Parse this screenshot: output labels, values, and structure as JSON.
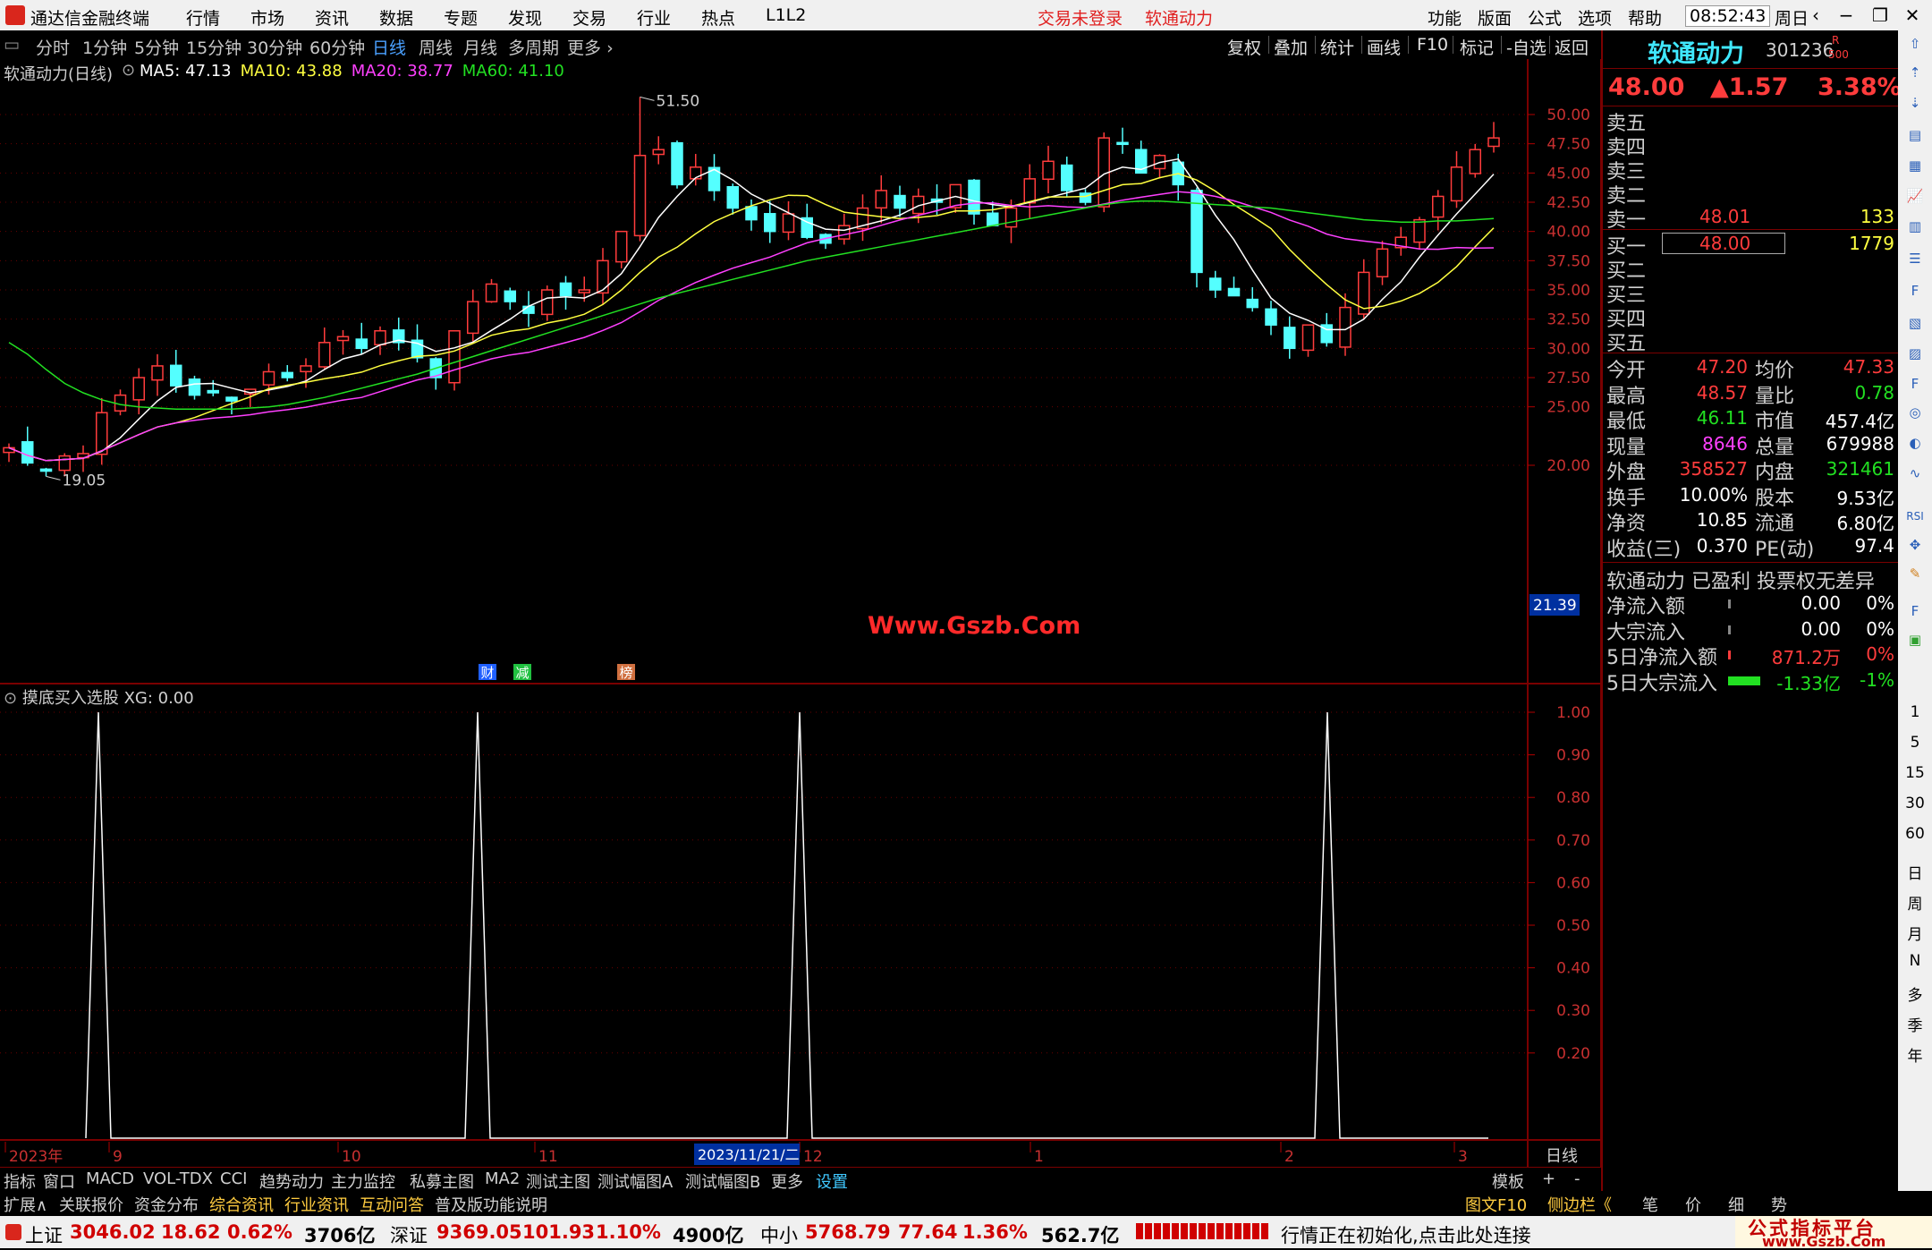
{
  "app": {
    "title": "通达信金融终端",
    "menu": [
      "行情",
      "市场",
      "资讯",
      "数据",
      "专题",
      "发现",
      "交易",
      "行业",
      "热点",
      "L1L2"
    ],
    "notice_login": "交易未登录",
    "notice_stock": "软通动力",
    "right_menu": [
      "功能",
      "版面",
      "公式",
      "选项",
      "帮助"
    ],
    "time": "08:52:43",
    "weekday": "周日"
  },
  "periods": [
    "分时",
    "1分钟",
    "5分钟",
    "15分钟",
    "30分钟",
    "60分钟",
    "日线",
    "周线",
    "月线",
    "多周期",
    "更多"
  ],
  "active_period": "日线",
  "right_tools": [
    "复权",
    "叠加",
    "统计",
    "画线",
    "F10",
    "标记",
    "-自选",
    "返回"
  ],
  "main_chart": {
    "name": "软通动力(日线)",
    "ma_labels": [
      {
        "text": "MA5: 47.13",
        "color": "#ffffff"
      },
      {
        "text": "MA10: 43.88",
        "color": "#ffff40"
      },
      {
        "text": "MA20: 38.77",
        "color": "#ff40ff"
      },
      {
        "text": "MA60: 41.10",
        "color": "#22e022"
      }
    ],
    "high_mark": "51.50",
    "low_mark": "19.05",
    "cur_price_tag": "21.39",
    "watermark": "Www.Gszb.Com",
    "events": [
      "财",
      "减",
      "榜"
    ],
    "y_ticks": [
      "50.00",
      "47.50",
      "45.00",
      "42.50",
      "40.00",
      "37.50",
      "35.00",
      "32.50",
      "30.00",
      "27.50",
      "25.00",
      "20.00"
    ]
  },
  "sub_chart": {
    "name": "摸底买入选股",
    "value_label": "XG: 0.00",
    "y_ticks": [
      "1.00",
      "0.90",
      "0.80",
      "0.70",
      "0.60",
      "0.50",
      "0.40",
      "0.30",
      "0.20"
    ]
  },
  "x_axis": {
    "labels": [
      "2023年",
      "9",
      "10",
      "11",
      "12",
      "1",
      "2",
      "3"
    ],
    "cursor_date": "2023/11/21/二",
    "period": "日线"
  },
  "quote": {
    "stock_name": "软通动力",
    "code": "301236",
    "badge_r": "R",
    "badge_500": "500",
    "price": "48.00",
    "change": "▲1.57",
    "pct": "3.38%",
    "sell": [
      {
        "label": "卖五",
        "price": "",
        "vol": ""
      },
      {
        "label": "卖四",
        "price": "",
        "vol": ""
      },
      {
        "label": "卖三",
        "price": "",
        "vol": ""
      },
      {
        "label": "卖二",
        "price": "",
        "vol": ""
      },
      {
        "label": "卖一",
        "price": "48.01",
        "vol": "133"
      }
    ],
    "buy": [
      {
        "label": "买一",
        "price": "48.00",
        "vol": "1779"
      },
      {
        "label": "买二",
        "price": "",
        "vol": ""
      },
      {
        "label": "买三",
        "price": "",
        "vol": ""
      },
      {
        "label": "买四",
        "price": "",
        "vol": ""
      },
      {
        "label": "买五",
        "price": "",
        "vol": ""
      }
    ],
    "stats": [
      {
        "l1": "今开",
        "v1": "47.20",
        "c1": "#ff3c3c",
        "l2": "均价",
        "v2": "47.33",
        "c2": "#ff3c3c"
      },
      {
        "l1": "最高",
        "v1": "48.57",
        "c1": "#ff3c3c",
        "l2": "量比",
        "v2": "0.78",
        "c2": "#22e022"
      },
      {
        "l1": "最低",
        "v1": "46.11",
        "c1": "#22e022",
        "l2": "市值",
        "v2": "457.4亿",
        "c2": "#ffffff"
      },
      {
        "l1": "现量",
        "v1": "8646",
        "c1": "#ff40ff",
        "l2": "总量",
        "v2": "679988",
        "c2": "#ffffff"
      },
      {
        "l1": "外盘",
        "v1": "358527",
        "c1": "#ff3c3c",
        "l2": "内盘",
        "v2": "321461",
        "c2": "#22e022"
      },
      {
        "l1": "换手",
        "v1": "10.00%",
        "c1": "#ffffff",
        "l2": "股本",
        "v2": "9.53亿",
        "c2": "#ffffff"
      },
      {
        "l1": "净资",
        "v1": "10.85",
        "c1": "#ffffff",
        "l2": "流通",
        "v2": "6.80亿",
        "c2": "#ffffff"
      },
      {
        "l1": "收益(三)",
        "v1": "0.370",
        "c1": "#ffffff",
        "l2": "PE(动)",
        "v2": "97.4",
        "c2": "#ffffff"
      }
    ],
    "desc": "软通动力 已盈利 投票权无差异",
    "flows": [
      {
        "label": "净流入额",
        "value": "0.00",
        "pct": "0%",
        "color": "#ffffff"
      },
      {
        "label": "大宗流入",
        "value": "0.00",
        "pct": "0%",
        "color": "#ffffff"
      },
      {
        "label": "5日净流入额",
        "value": "871.2万",
        "pct": "0%",
        "color": "#ff3c3c"
      },
      {
        "label": "5日大宗流入",
        "value": "-1.33亿",
        "pct": "-1%",
        "color": "#22e022"
      }
    ]
  },
  "side_numbers": [
    "1",
    "5",
    "15",
    "30",
    "60",
    "日",
    "周",
    "月",
    "N",
    "多",
    "季",
    "年"
  ],
  "tabs1": [
    "指标",
    "窗口",
    "MACD",
    "VOL-TDX",
    "CCI",
    "趋势动力",
    "主力监控",
    "私募主图",
    "MA2",
    "测试主图",
    "测试幅图A",
    "测试幅图B",
    "更多",
    "设置"
  ],
  "tabs1_right": [
    "模板",
    "+",
    "-"
  ],
  "tabs2": [
    "扩展∧",
    "关联报价",
    "资金分布",
    "综合资讯",
    "行业资讯",
    "互动问答",
    "普及版功能说明"
  ],
  "tabs2_right": [
    "图文F10",
    "侧边栏《",
    "笔",
    "价",
    "细",
    "势"
  ],
  "status": {
    "sh_label": "上证",
    "sh_val": "3046.02",
    "sh_chg": "18.62",
    "sh_pct": "0.62%",
    "sh_amt": "3706亿",
    "sz_label": "深证",
    "sz_val": "9369.05",
    "sz_chg": "101.93",
    "sz_pct": "1.10%",
    "sz_amt": "4900亿",
    "zx_label": "中小",
    "zx_val": "5768.79",
    "zx_chg": "77.64",
    "zx_pct": "1.36%",
    "zx_amt": "562.7亿",
    "msg": "行情正在初始化,点击此处连接",
    "brand_cn": "公式指标平台",
    "brand_url": "www.Gszb.Com"
  },
  "chart_data": [
    {
      "type": "line",
      "title": "软通动力(日线)",
      "series": [
        {
          "name": "MA5",
          "color": "#ffffff"
        },
        {
          "name": "MA10",
          "color": "#ffff40"
        },
        {
          "name": "MA20",
          "color": "#ff40ff"
        },
        {
          "name": "MA60",
          "color": "#22e022"
        }
      ],
      "ylim": [
        19,
        51.5
      ],
      "close_approx": [
        21.5,
        20.2,
        19.5,
        20.8,
        21.0,
        24.5,
        26.0,
        27.5,
        28.5,
        26.8,
        26.0,
        26.2,
        25.5,
        26.5,
        28.0,
        27.5,
        28.5,
        30.5,
        31.0,
        30.0,
        31.5,
        30.5,
        29.2,
        27.5,
        31.5,
        34.0,
        35.5,
        34.0,
        33.0,
        35.0,
        34.5,
        35.0,
        37.5,
        40.0,
        46.5,
        47.0,
        44.0,
        45.5,
        43.5,
        42.0,
        41.0,
        40.0,
        41.5,
        39.5,
        39.0,
        40.5,
        42.0,
        43.5,
        42.0,
        43.0,
        42.5,
        44.0,
        41.5,
        40.5,
        42.0,
        44.5,
        46.0,
        43.5,
        42.5,
        48.0,
        47.5,
        45.0,
        46.5,
        44.0,
        36.5,
        35.0,
        34.5,
        33.5,
        32.0,
        30.0,
        32.0,
        30.5,
        33.5,
        36.5,
        38.5,
        39.5,
        41.0,
        43.0,
        45.5,
        47.0,
        48.0
      ]
    },
    {
      "type": "line",
      "title": "摸底买入选股",
      "series": [
        {
          "name": "XG",
          "color": "#ffffff"
        }
      ],
      "peaks_at_month_labels": [
        "9",
        "10",
        "11",
        "2"
      ],
      "ylim": [
        0,
        1
      ]
    }
  ]
}
